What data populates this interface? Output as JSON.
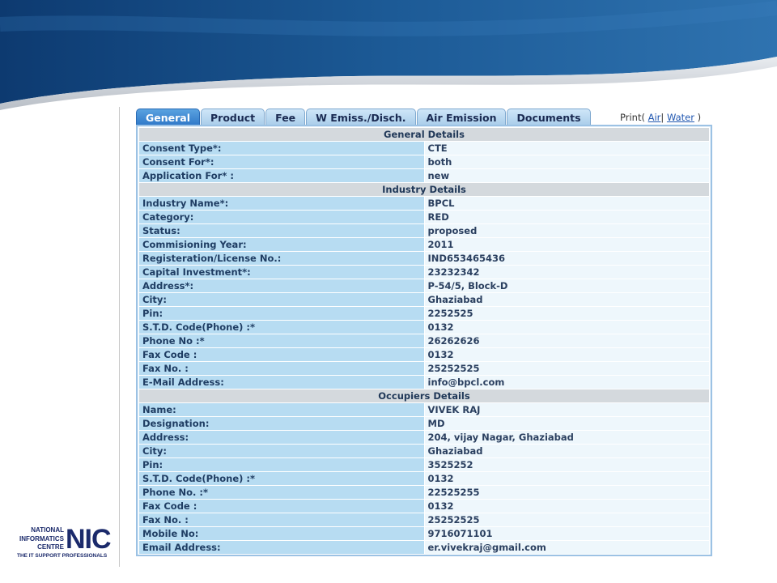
{
  "tabs": [
    "General",
    "Product",
    "Fee",
    "W Emiss./Disch.",
    "Air Emission",
    "Documents"
  ],
  "print": {
    "label": "Print(",
    "air": "Air",
    "separator": "|",
    "water": "Water",
    "close": ")"
  },
  "sections": [
    {
      "title": "General Details",
      "rows": [
        {
          "label": "Consent Type*:",
          "value": "CTE"
        },
        {
          "label": "Consent For*:",
          "value": "both"
        },
        {
          "label": "Application For* :",
          "value": "new"
        }
      ]
    },
    {
      "title": "Industry Details",
      "rows": [
        {
          "label": "Industry Name*:",
          "value": "BPCL"
        },
        {
          "label": "Category:",
          "value": "RED"
        },
        {
          "label": "Status:",
          "value": "proposed"
        },
        {
          "label": "Commisioning Year:",
          "value": "2011"
        },
        {
          "label": "Registeration/License No.:",
          "value": "IND653465436"
        },
        {
          "label": "Capital Investment*:",
          "value": "23232342"
        },
        {
          "label": "Address*:",
          "value": "P-54/5, Block-D"
        },
        {
          "label": "City:",
          "value": "Ghaziabad"
        },
        {
          "label": "Pin:",
          "value": "2252525"
        },
        {
          "label": "S.T.D. Code(Phone) :*",
          "value": "0132"
        },
        {
          "label": "Phone No :*",
          "value": "26262626"
        },
        {
          "label": "Fax Code :",
          "value": "0132"
        },
        {
          "label": "Fax No. :",
          "value": "25252525"
        },
        {
          "label": "E-Mail Address:",
          "value": "info@bpcl.com"
        }
      ]
    },
    {
      "title": "Occupiers Details",
      "rows": [
        {
          "label": "Name:",
          "value": "VIVEK RAJ"
        },
        {
          "label": "Designation:",
          "value": "MD"
        },
        {
          "label": "Address:",
          "value": "204, vijay Nagar, Ghaziabad"
        },
        {
          "label": "City:",
          "value": "Ghaziabad"
        },
        {
          "label": "Pin:",
          "value": "3525252"
        },
        {
          "label": "S.T.D. Code(Phone) :*",
          "value": "0132"
        },
        {
          "label": "Phone No. :*",
          "value": "22525255"
        },
        {
          "label": "Fax Code :",
          "value": "0132"
        },
        {
          "label": "Fax No. :",
          "value": "25252525"
        },
        {
          "label": "Mobile No:",
          "value": "9716071101"
        },
        {
          "label": "Email Address:",
          "value": "er.vivekraj@gmail.com"
        }
      ]
    }
  ],
  "logo": {
    "line1": "NATIONAL",
    "line2": "INFORMATICS",
    "line3": "CENTRE",
    "mark": "NIC",
    "tagline": "THE IT SUPPORT PROFESSIONALS"
  },
  "colors": {
    "active_tab": "#3f8bd6",
    "label_cell": "#b7dcf2",
    "value_cell": "#eef7fc",
    "section_header": "#d4d9dd",
    "banner": "#1a4f86"
  }
}
